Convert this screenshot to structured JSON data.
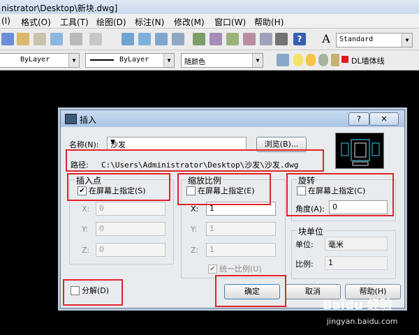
{
  "window": {
    "title": "nistrator\\Desktop\\新块.dwg]"
  },
  "menu": [
    "(I)",
    "格式(O)",
    "工具(T)",
    "绘图(D)",
    "标注(N)",
    "修改(M)",
    "窗口(W)",
    "帮助(H)"
  ],
  "toolbar": {
    "style_combo": "Standard",
    "linetype_combo": "ByLayer",
    "lineweight_combo": "ByLayer",
    "color_combo": "随颜色",
    "layer_name": "DL墙体线"
  },
  "dialog": {
    "title": "插入",
    "help_glyph": "?",
    "close_glyph": "✕",
    "name_label": "名称(N):",
    "name_value": "沙发",
    "browse_label": "浏览(B)...",
    "path_label": "路径:",
    "path_value": "C:\\Users\\Administrator\\Desktop\\沙发\\沙发.dwg",
    "insertion": {
      "title": "插入点",
      "on_screen_label": "在屏幕上指定(S)",
      "on_screen_checked": true,
      "x_label": "X:",
      "x_value": "0",
      "y_label": "Y:",
      "y_value": "0",
      "z_label": "Z:",
      "z_value": "0"
    },
    "scale": {
      "title": "缩放比例",
      "on_screen_label": "在屏幕上指定(E)",
      "on_screen_checked": false,
      "x_label": "X:",
      "x_value": "1",
      "y_label": "Y:",
      "y_value": "1",
      "z_label": "Z:",
      "z_value": "1",
      "uniform_label": "统一比例(U)",
      "uniform_checked": true
    },
    "rotation": {
      "title": "旋转",
      "on_screen_label": "在屏幕上指定(C)",
      "on_screen_checked": false,
      "angle_label": "角度(A):",
      "angle_value": "0"
    },
    "block_unit": {
      "title": "块单位",
      "unit_label": "单位:",
      "unit_value": "毫米",
      "factor_label": "比例:",
      "factor_value": "1"
    },
    "explode_label": "分解(D)",
    "explode_checked": false,
    "ok_label": "确定",
    "cancel_label": "取消",
    "help_label": "帮助(H)"
  },
  "watermark": {
    "brand": "Baidu 经验",
    "url": "jingyan.baidu.com"
  }
}
